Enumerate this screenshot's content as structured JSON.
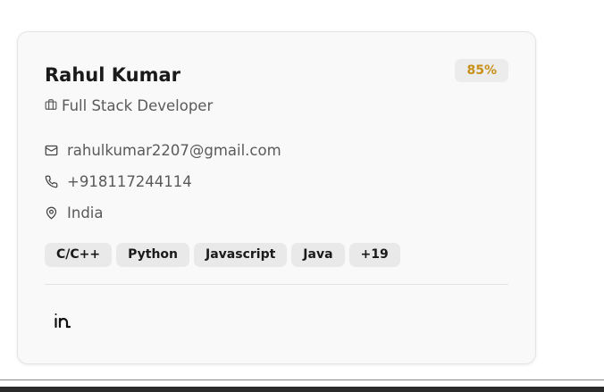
{
  "profile": {
    "name": "Rahul Kumar",
    "match_score": "85%",
    "role": "Full Stack Developer",
    "email": "rahulkumar2207@gmail.com",
    "phone": "+918117244114",
    "location": "India",
    "skills": [
      "C/C++",
      "Python",
      "Javascript",
      "Java",
      "+19"
    ],
    "social": {
      "linkedin_icon": "linkedin-icon"
    }
  },
  "colors": {
    "badge_text": "#c8901a",
    "card_bg": "#f9f9f9",
    "tag_bg": "#e9e9e9"
  },
  "icons": {
    "role": "briefcase-icon",
    "email": "mail-icon",
    "phone": "phone-icon",
    "location": "map-pin-icon"
  }
}
